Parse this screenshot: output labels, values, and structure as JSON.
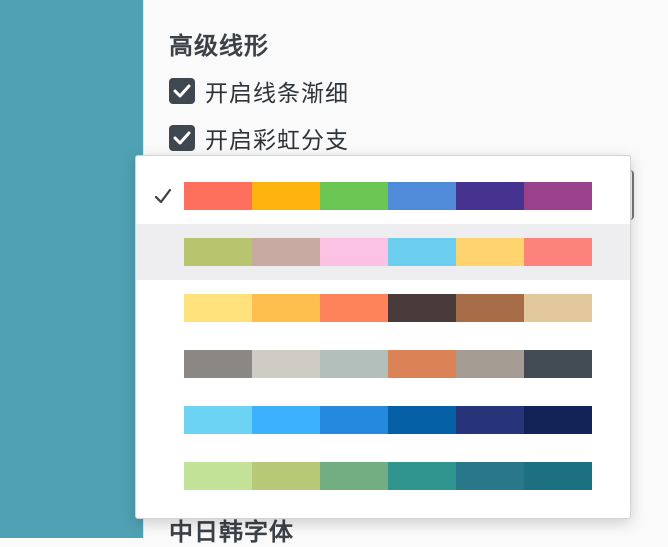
{
  "settings": {
    "section_title": "高级线形",
    "options": [
      {
        "label": "开启线条渐细",
        "checked": true
      },
      {
        "label": "开启彩虹分支",
        "checked": true
      }
    ],
    "next_section_title": "中日韩字体"
  },
  "color_dropdown": {
    "selected_index": 0,
    "highlighted_index": 1,
    "palettes": [
      [
        "#ff6f5e",
        "#ffb30f",
        "#6cc653",
        "#4f8bd9",
        "#46328f",
        "#99418a"
      ],
      [
        "#b9c56e",
        "#c8aaa3",
        "#fcc2e4",
        "#6ccfef",
        "#ffd46e",
        "#fb837b"
      ],
      [
        "#ffe27c",
        "#ffbf4f",
        "#ff835a",
        "#4a3b3b",
        "#a66d48",
        "#e4c89d"
      ],
      [
        "#8b8883",
        "#cfcbc5",
        "#b2bfba",
        "#db8357",
        "#a59c94",
        "#434c55"
      ],
      [
        "#6dd3f2",
        "#3bb2fb",
        "#2689e0",
        "#0660a6",
        "#27347a",
        "#122358"
      ],
      [
        "#c2e298",
        "#b6c976",
        "#72ae82",
        "#30958f",
        "#29788a",
        "#1d7080"
      ]
    ]
  }
}
